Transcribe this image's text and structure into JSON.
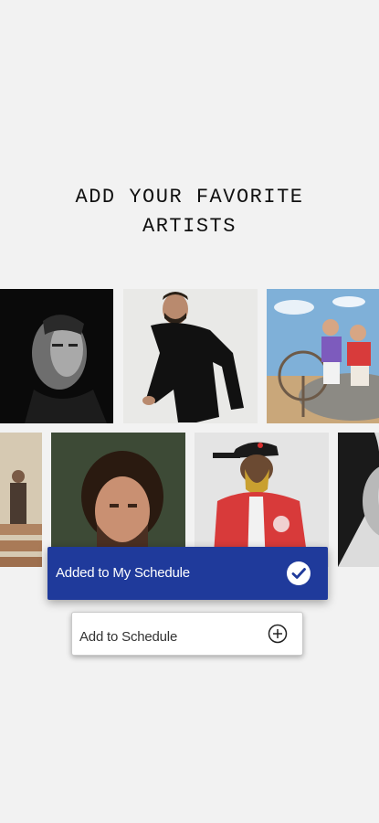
{
  "screen": {
    "heading_line1": "ADD YOUR FAVORITE",
    "heading_line2": "ARTISTS"
  },
  "artists_row_1": [
    {
      "name": "artist-photo-1",
      "icon": "portrait-bw-man"
    },
    {
      "name": "artist-photo-2",
      "icon": "man-black-outfit"
    },
    {
      "name": "artist-photo-3",
      "icon": "duo-on-rock"
    }
  ],
  "artists_row_2": [
    {
      "name": "artist-photo-4",
      "icon": "staircase-figure"
    },
    {
      "name": "artist-photo-5",
      "icon": "curly-hair-man"
    },
    {
      "name": "artist-photo-6",
      "icon": "man-red-jacket-cap"
    },
    {
      "name": "artist-photo-7",
      "icon": "woman-portrait-bw"
    }
  ],
  "toast": {
    "message": "Added to My Schedule",
    "icon": "check-circle-icon",
    "background": "#1f3a9b"
  },
  "add_button": {
    "label": "Add to Schedule",
    "icon": "plus-circle-icon"
  }
}
